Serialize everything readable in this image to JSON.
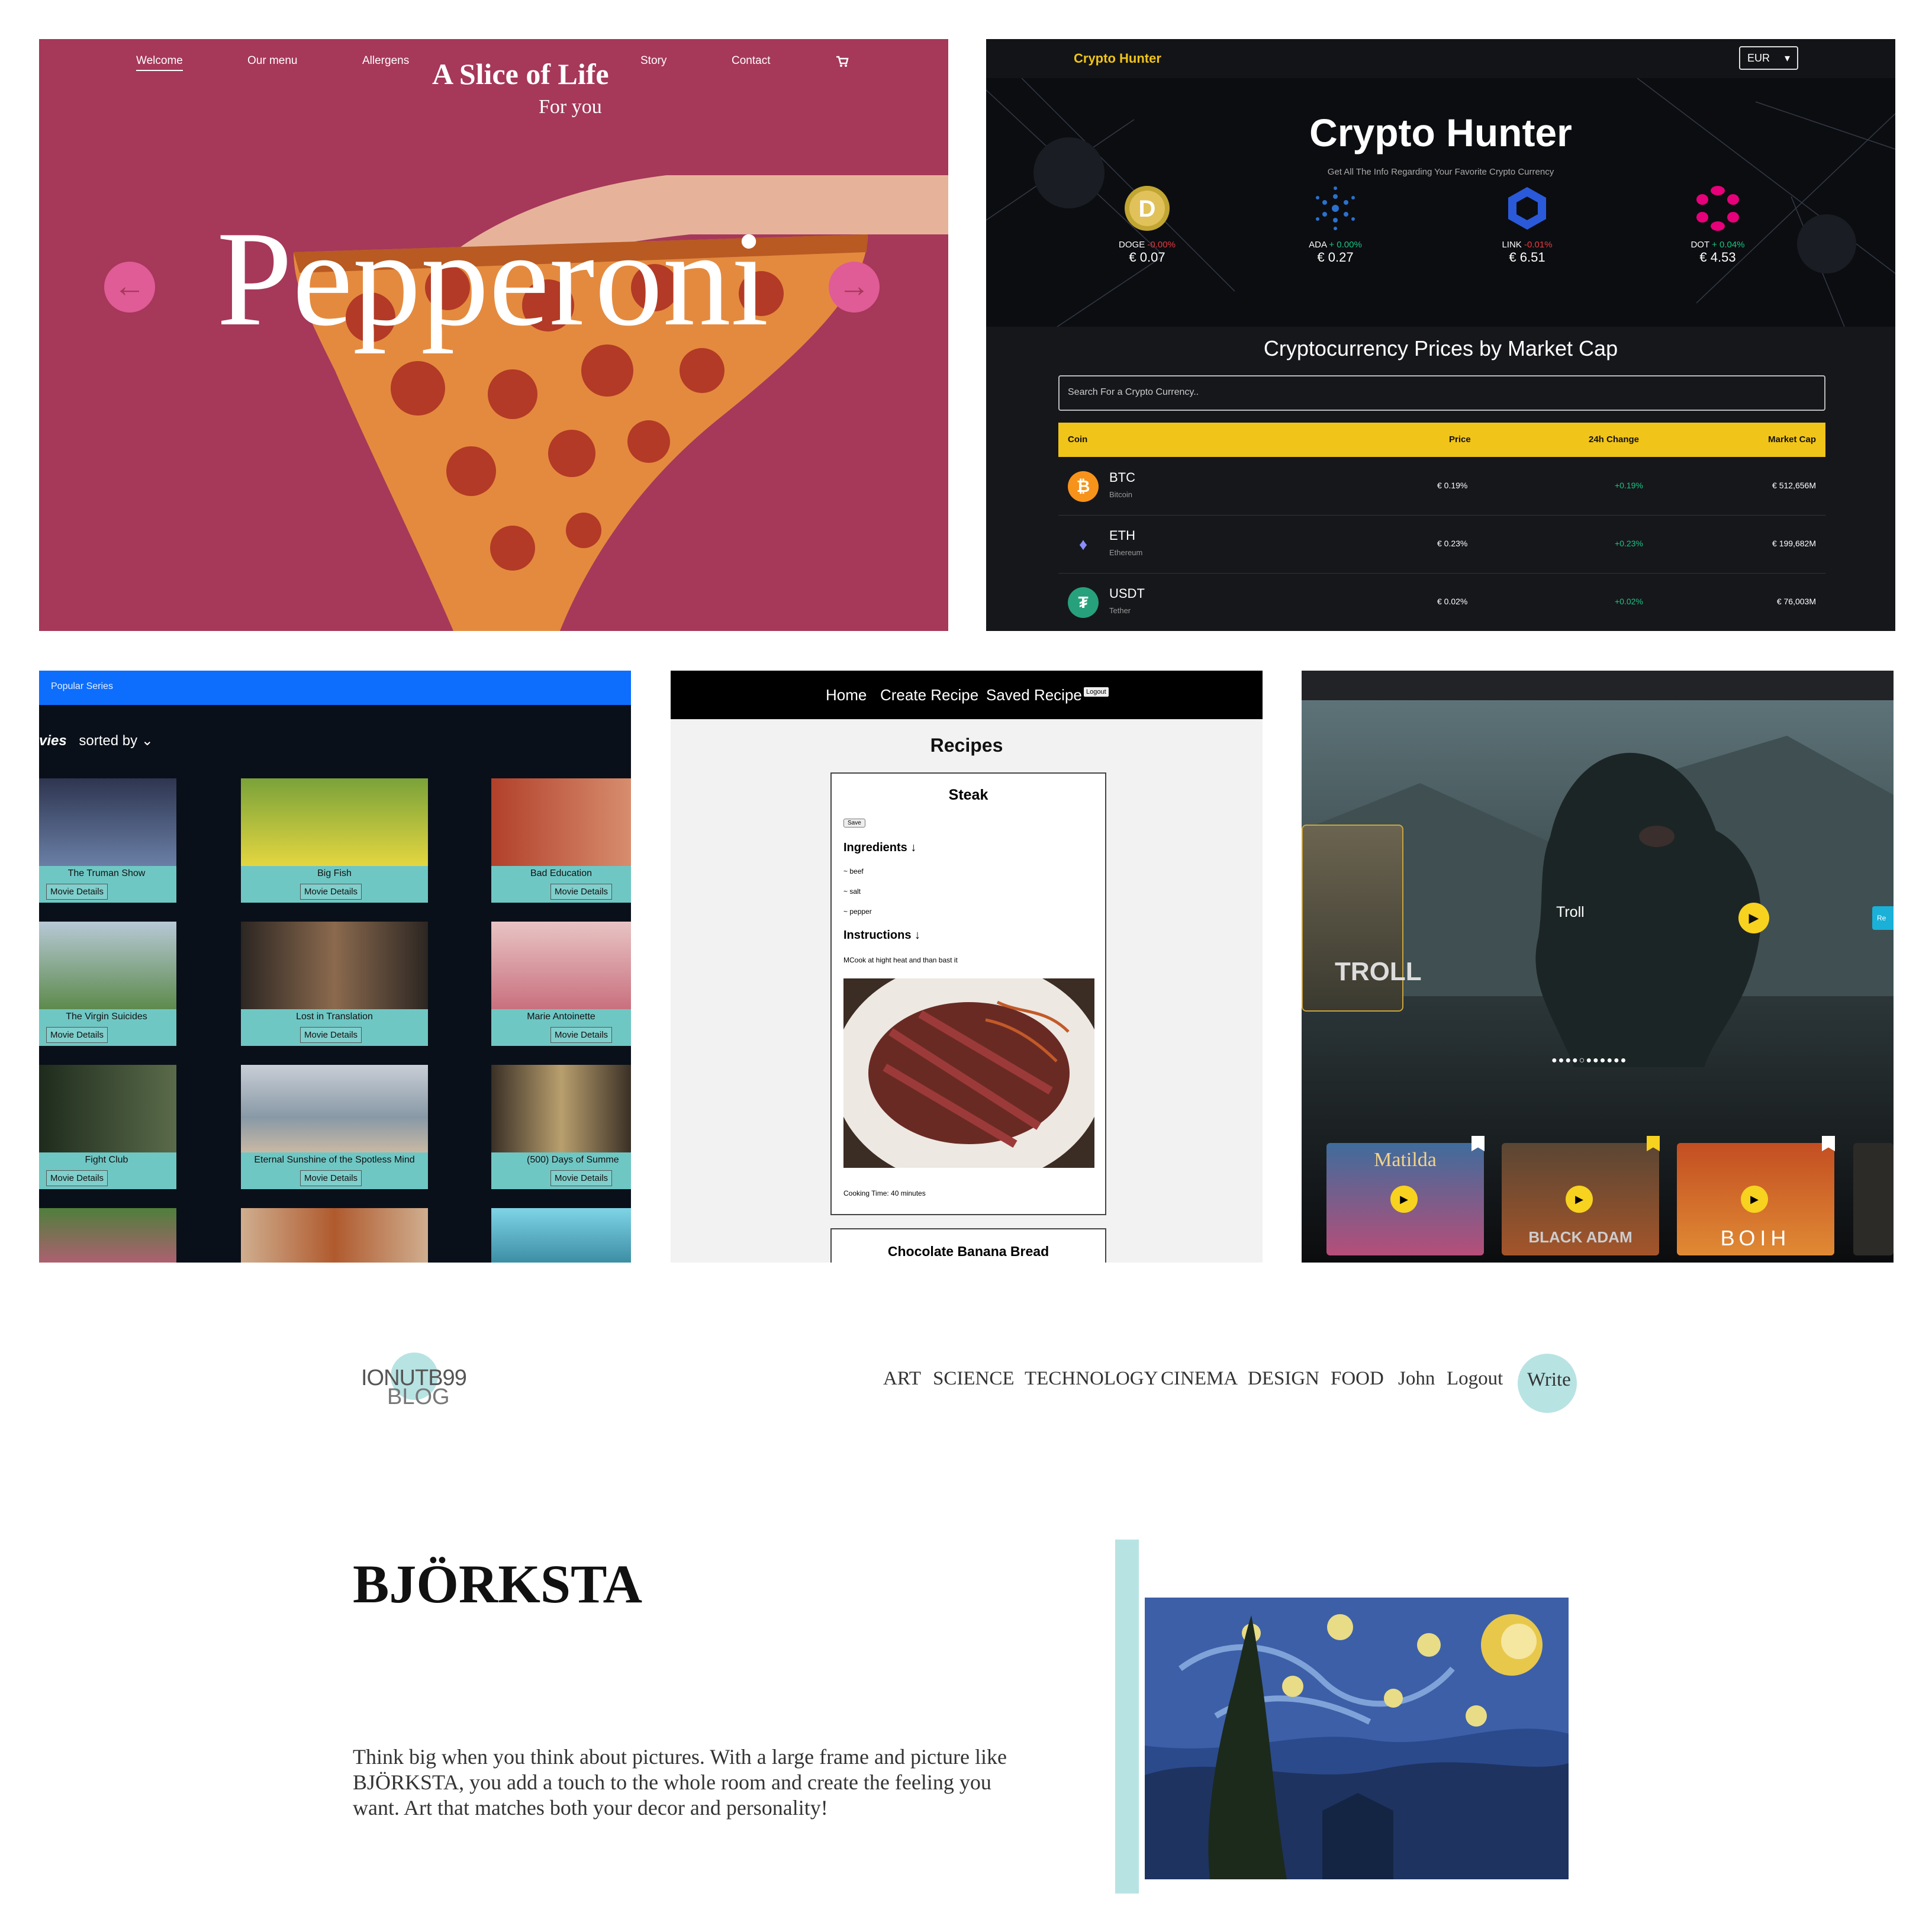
{
  "pizza": {
    "nav": [
      "Welcome",
      "Our menu",
      "Allergens",
      "Story",
      "Contact"
    ],
    "brand": "A Slice of Life",
    "subtitle": "For you",
    "headline": "Pepperoni",
    "cart_icon": "cart-icon",
    "colors": {
      "background": "#a6385a",
      "arrow": "#e05c96"
    }
  },
  "crypto": {
    "logo": "Crypto Hunter",
    "currency": "EUR",
    "title": "Crypto Hunter",
    "tagline": "Get All The Info Regarding Your Favorite Crypto Currency",
    "trending": [
      {
        "symbol": "DOGE",
        "change": "-0.00%",
        "price": "€ 0.07"
      },
      {
        "symbol": "ADA",
        "change": "+ 0.00%",
        "price": "€ 0.27"
      },
      {
        "symbol": "LINK",
        "change": "-0.01%",
        "price": "€ 6.51"
      },
      {
        "symbol": "DOT",
        "change": "+ 0.04%",
        "price": "€ 4.53"
      }
    ],
    "section_title": "Cryptocurrency Prices by Market Cap",
    "search_placeholder": "Search For a Crypto Currency..",
    "table_headers": [
      "Coin",
      "Price",
      "24h Change",
      "Market Cap"
    ],
    "rows": [
      {
        "symbol": "BTC",
        "name": "Bitcoin",
        "price": "€ 0.19%",
        "change": "+0.19%",
        "market_cap": "€ 512,656M"
      },
      {
        "symbol": "ETH",
        "name": "Ethereum",
        "price": "€ 0.23%",
        "change": "+0.23%",
        "market_cap": "€ 199,682M"
      },
      {
        "symbol": "USDT",
        "name": "Tether",
        "price": "€ 0.02%",
        "change": "+0.02%",
        "market_cap": "€ 76,003M"
      }
    ],
    "colors": {
      "accent": "#f0c419",
      "up": "#16c784",
      "down": "#ea3943"
    }
  },
  "movies": {
    "topbar": "Popular Series",
    "heading": "vies",
    "sort_label": "sorted by",
    "button_label": "Movie Details",
    "cards": [
      "The Truman Show",
      "Big Fish",
      "Bad Education",
      "The Virgin Suicides",
      "Lost in Translation",
      "Marie Antoinette",
      "Fight Club",
      "Eternal Sunshine of the Spotless Mind",
      "(500) Days of Summe"
    ]
  },
  "recipes": {
    "nav": [
      "Home",
      "Create Recipe",
      "Saved Recipe"
    ],
    "logout": "Logout",
    "title": "Recipes",
    "card": {
      "name": "Steak",
      "save": "Save",
      "ingredients_label": "Ingredients ↓",
      "ingredients": [
        "~ beef",
        "~ salt",
        "~ pepper"
      ],
      "instructions_label": "Instructions ↓",
      "instructions": "MCook at hight heat and than bast it",
      "cooking_time": "Cooking Time: 40 minutes"
    },
    "next_card": "Chocolate Banana Bread"
  },
  "troll": {
    "title": "Troll",
    "poster_text": "TROLL",
    "side_button": "Re",
    "thumbs": [
      "Matilda",
      "BLACK ADAM",
      "ВОІН"
    ]
  },
  "blog": {
    "logo_line1": "IONUTB99",
    "logo_line2": "BLOG",
    "nav": [
      "ART",
      "SCIENCE",
      "TECHNOLOGY",
      "CINEMA",
      "DESIGN",
      "FOOD",
      "John",
      "Logout"
    ],
    "write": "Write",
    "post_title": "BJÖRKSTA",
    "post_body": "Think big when you think about pictures. With a large frame and picture like BJÖRKSTA, you add a touch to the whole room and create the feeling you want. Art that matches both your decor and personality!",
    "colors": {
      "accent": "#b8e3e3"
    }
  }
}
